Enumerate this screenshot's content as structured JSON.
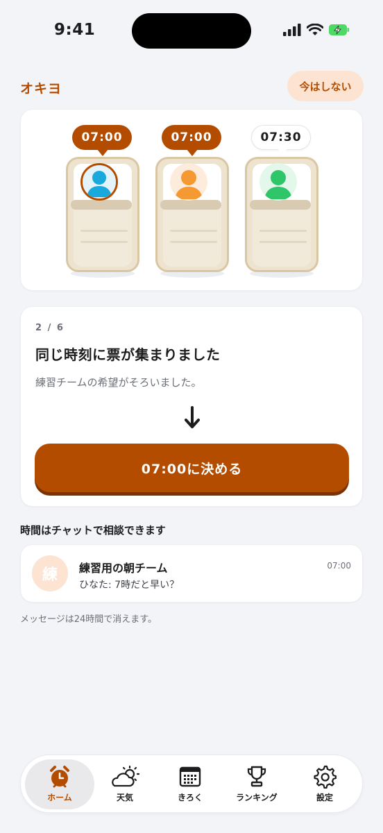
{
  "status_bar": {
    "time": "9:41"
  },
  "app": {
    "title": "オキヨ",
    "skip_label": "今はしない"
  },
  "illustration": {
    "members": [
      {
        "time": "07:00",
        "style": "selected",
        "avatar_color": "#1aa9dd"
      },
      {
        "time": "07:00",
        "style": "selected",
        "avatar_color": "#f59a33"
      },
      {
        "time": "07:30",
        "style": "plain",
        "avatar_color": "#2fc66a"
      }
    ]
  },
  "vote": {
    "step": "2 / 6",
    "title": "同じ時刻に票が集まりました",
    "subtitle": "練習チームの希望がそろいました。",
    "decide_label": "07:00に決める"
  },
  "chat": {
    "heading": "時間はチャットで相談できます",
    "avatar_char": "練",
    "name": "練習用の朝チーム",
    "last_message": "ひなた: 7時だと早い？",
    "time": "07:00",
    "note": "メッセージは24時間で消えます。"
  },
  "tabs": [
    {
      "label": "ホーム",
      "icon": "alarm-clock-icon",
      "active": true
    },
    {
      "label": "天気",
      "icon": "weather-icon",
      "active": false
    },
    {
      "label": "きろく",
      "icon": "calendar-icon",
      "active": false
    },
    {
      "label": "ランキング",
      "icon": "trophy-icon",
      "active": false
    },
    {
      "label": "設定",
      "icon": "gear-icon",
      "active": false
    }
  ],
  "colors": {
    "accent": "#b44c00",
    "accent_soft": "#fde3d2",
    "background": "#f3f4f7"
  }
}
